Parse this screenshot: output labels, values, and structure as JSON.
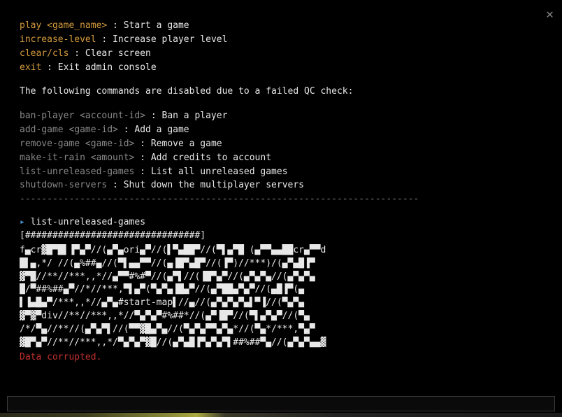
{
  "close_glyph": "✕",
  "enabled_commands": [
    {
      "name": "play <game_name>",
      "desc": " : Start a game"
    },
    {
      "name": "increase-level",
      "desc": " : Increase player level"
    },
    {
      "name": "clear/cls",
      "desc": " : Clear screen"
    },
    {
      "name": "exit",
      "desc": " : Exit admin console"
    }
  ],
  "notice": "The following commands are disabled due to a failed QC check:",
  "disabled_commands": [
    {
      "name": "ban-player <account-id>",
      "desc": " : Ban a player"
    },
    {
      "name": "add-game <game-id>",
      "desc": " : Add a game"
    },
    {
      "name": "remove-game <game-id>",
      "desc": " : Remove a game"
    },
    {
      "name": "make-it-rain <amount>",
      "desc": " : Add credits to account"
    },
    {
      "name": "list-unreleased-games",
      "desc": " : List all unreleased games"
    },
    {
      "name": "shutdown-servers",
      "desc": " : Shut down the multiplayer servers"
    }
  ],
  "divider": "-------------------------------------------------------------------------",
  "prompt_arrow": "▸ ",
  "prompt_command": "list-unreleased-games",
  "progress_bar": "[################################]",
  "glitch_lines": [
    "f▄cr▓█▀█▌▐▀▄▀//(▄▀▄ori▄▀//(▌▀▄██▀//(▀▌▄▀█ (▄▀▀▄▄██cr▄▀▀d",
    "█▌▄,*/ //(▄%##▄//(▀▌▄▄▀▀//(▄▐█▀▄█▀//(▐▀)//***)/(▄▀▄█▐▀",
    "▓▀█//**//***,,*//▄▀▀#%#▀//(▄▀▌//(▐█▀▄▀//(▄▀▄▀▄//(▄▀▄▀▄",
    "█/▀##%##▄▀//*//***,▀▌▄▀(▀▄▀▄▐█▄▀//(▄▀██▄▀▄▀//(▄█▐▀(▄",
    "▌▐▄█▄▀/***,,*//▄▀▄#start-map▌//▄//(▄▀▄▀▄▀▄▌▀▐//(▀▄▀▄",
    "▓▀▓▀div//**//***,,*//▀▄▀▄▀#%##*//(▄▀▐█▀//(▀▌▄▀▄▀//(▀▄",
    "/*/▀▄//**//(▄▀▄▀▌//(▀▀▓█▄▀▄//(▀▄▀▄▀▀▄▀▄*//(▀▄*/***,▀▄▀",
    "▓█▀▄▀//**//***,,*/▀▄▀▄▀▓█//(▄▀▄█▐▀▄▀▄▀▌##%##▀▄//(▄▀▄▀▄▄▓"
  ],
  "error_message": "Data corrupted."
}
